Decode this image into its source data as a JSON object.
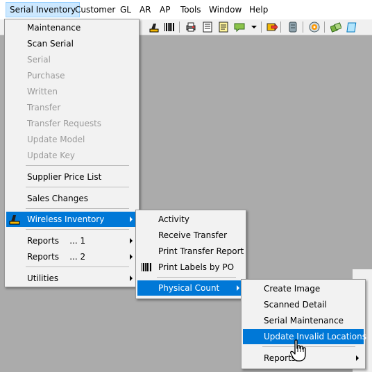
{
  "menubar": {
    "items": [
      "Serial Inventory",
      "Customer",
      "GL",
      "AR",
      "AP",
      "Tools",
      "Window",
      "Help"
    ],
    "active": "Serial Inventory"
  },
  "toolbar": {
    "icons": [
      "scanner-icon",
      "barcode-icon",
      "printer-icon",
      "document-icon",
      "note-icon",
      "comment-icon",
      "dropdown-arrow-icon",
      "transfer-icon",
      "database-icon",
      "disc-icon",
      "cards-icon",
      "notepad-icon"
    ]
  },
  "menu1": {
    "items": {
      "maintenance": "Maintenance",
      "scan_serial": "Scan Serial",
      "serial": "Serial",
      "purchase": "Purchase",
      "written": "Written",
      "transfer": "Transfer",
      "transfer_requests": "Transfer Requests",
      "update_model": "Update Model",
      "update_key": "Update Key",
      "supplier_price_list": "Supplier Price List",
      "sales_changes": "Sales Changes",
      "wireless_inventory": "Wireless Inventory",
      "reports1": "Reports    ... 1",
      "reports2": "Reports    ... 2",
      "utilities": "Utilities"
    },
    "disabled": [
      "Serial",
      "Purchase",
      "Written",
      "Transfer",
      "Transfer Requests",
      "Update Model",
      "Update Key"
    ]
  },
  "menu2": {
    "items": {
      "activity": "Activity",
      "receive_transfer": "Receive Transfer",
      "print_transfer_report": "Print Transfer Report",
      "print_labels_by_po": "Print Labels by PO",
      "physical_count": "Physical Count"
    }
  },
  "menu3": {
    "items": {
      "create_image": "Create Image",
      "scanned_detail": "Scanned Detail",
      "serial_maintenance": "Serial Maintenance",
      "update_invalid_locations": "Update Invalid Locations",
      "reports": "Reports"
    }
  },
  "colors": {
    "highlight": "#0078d7",
    "menubar_active": "#cce8ff",
    "background": "#ababab",
    "disabled_text": "#9a9a9a"
  }
}
